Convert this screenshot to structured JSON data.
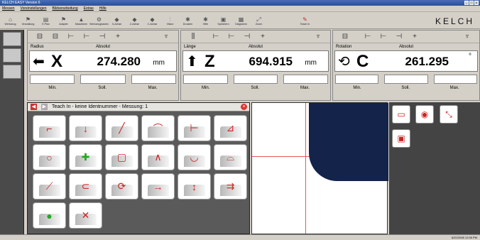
{
  "window": {
    "title": "KELCH EASY Version 6"
  },
  "menu": [
    "Messen",
    "Voreinstellungen",
    "Bildverarbeitung",
    "Extras",
    "Hilfe"
  ],
  "toolbar": [
    {
      "label": "Werkzeug",
      "icon": "home-icon"
    },
    {
      "label": "Verwaltung",
      "icon": "flag-icon"
    },
    {
      "label": "E.Plan",
      "icon": "list-icon"
    },
    {
      "label": "Adapter",
      "icon": "flag-icon"
    },
    {
      "label": "Maschinen",
      "icon": "tool-icon"
    },
    {
      "label": "Werkzeugkasten",
      "icon": "gear-icon"
    },
    {
      "label": "X-Achse",
      "icon": "axis-icon"
    },
    {
      "label": "Z-Achse",
      "icon": "axis-icon"
    },
    {
      "label": "C-Achse",
      "icon": "axis-icon"
    },
    {
      "label": "Vision",
      "icon": "tool-icon"
    },
    {
      "label": "Drucken",
      "icon": "gear-icon"
    },
    {
      "label": "Hilfe",
      "icon": "gear-icon"
    },
    {
      "label": "Speichern",
      "icon": "save-icon"
    },
    {
      "label": "Diagramm",
      "icon": "chart-icon"
    },
    {
      "label": "Zoom",
      "icon": "zoom-icon"
    },
    {
      "label": "Teach In",
      "icon": "teach-icon"
    }
  ],
  "logo": "KELCH",
  "axes": [
    {
      "label": "Radius",
      "mode": "Absolut",
      "letter": "X",
      "value": "274.280",
      "unit": "mm",
      "min": "Min.",
      "soll": "Soll.",
      "max": "Max."
    },
    {
      "label": "Länge",
      "mode": "Absolut",
      "letter": "Z",
      "value": "694.915",
      "unit": "mm",
      "min": "Min.",
      "soll": "Soll.",
      "max": "Max."
    },
    {
      "label": "Rotation",
      "mode": "Absolut",
      "letter": "C",
      "value": "261.295",
      "unit": "°",
      "min": "Min.",
      "soll": "Soll.",
      "max": "Max."
    }
  ],
  "teach": {
    "title": "Teach In - keine Identnummer - Messung: 1"
  },
  "status": "6/20/2008 12:06 PM"
}
